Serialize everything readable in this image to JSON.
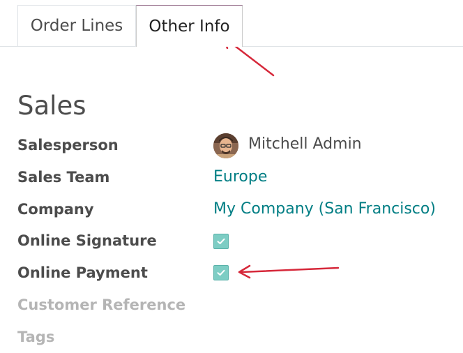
{
  "tabs": {
    "order_lines": "Order Lines",
    "other_info": "Other Info",
    "active": "Other Info"
  },
  "section": {
    "title": "Sales"
  },
  "fields": {
    "salesperson": {
      "label": "Salesperson",
      "value": "Mitchell Admin",
      "icon": "avatar"
    },
    "sales_team": {
      "label": "Sales Team",
      "value": "Europe"
    },
    "company": {
      "label": "Company",
      "value": "My Company (San Francisco)"
    },
    "online_signature": {
      "label": "Online Signature",
      "checked": true,
      "icon": "check-icon"
    },
    "online_payment": {
      "label": "Online Payment",
      "checked": true,
      "icon": "check-icon"
    },
    "customer_reference": {
      "label": "Customer Reference",
      "value": ""
    },
    "tags": {
      "label": "Tags",
      "value": ""
    }
  },
  "colors": {
    "link": "#017e84",
    "checkbox_fill": "#7dcdc4",
    "annotation_arrow": "#d6283a",
    "active_tab_top": "#875a7b"
  },
  "annotations": [
    {
      "icon": "arrow-icon",
      "target": "Other Info tab"
    },
    {
      "icon": "arrow-icon",
      "target": "Online Payment checkbox"
    }
  ]
}
